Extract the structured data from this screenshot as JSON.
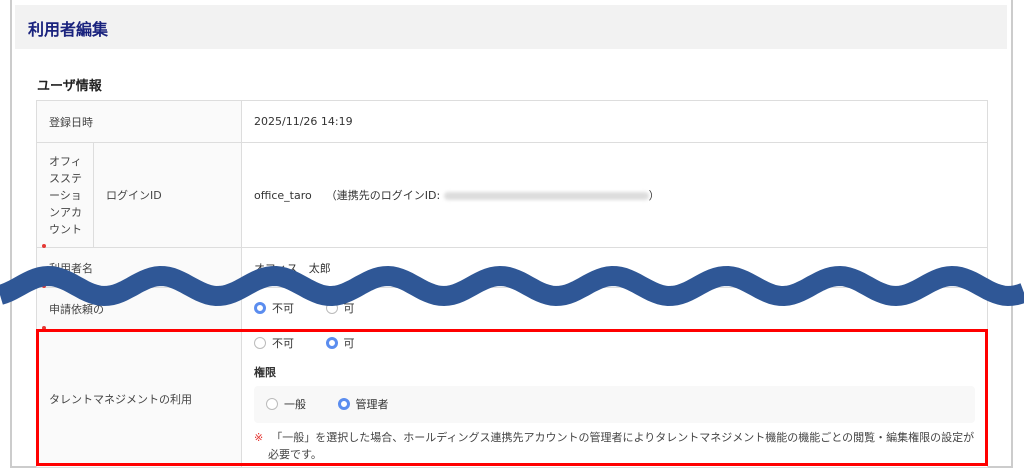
{
  "page_title": "利用者編集",
  "section_title": "ユーザ情報",
  "rows": {
    "registered": {
      "label": "登録日時",
      "value": "2025/11/26 14:19"
    },
    "login": {
      "group_label": "オフィスステーションアカウント",
      "label": "ログインID",
      "value": "office_taro",
      "linked_prefix": "（連携先のログインID:",
      "linked_suffix": "）"
    },
    "user_name": {
      "label": "利用者名",
      "value": "オフィス　太郎"
    },
    "request": {
      "label": "申請依頼の",
      "options": [
        "不可",
        "可"
      ],
      "selected": "不可"
    },
    "talent": {
      "label": "タレントマネジメントの利用",
      "options": [
        "不可",
        "可"
      ],
      "selected": "可",
      "perm_label": "権限",
      "perm_options": [
        "一般",
        "管理者"
      ],
      "perm_selected": "管理者",
      "note_mark": "※",
      "note": "「一般」を選択した場合、ホールディングス連携先アカウントの管理者によりタレントマネジメント機能の機能ごとの閲覧・編集権限の設定が必要です。"
    }
  },
  "colors": {
    "title": "#1a237e",
    "wave": "#2f5796",
    "highlight": "#ff0000",
    "radio": "#5b8def"
  }
}
